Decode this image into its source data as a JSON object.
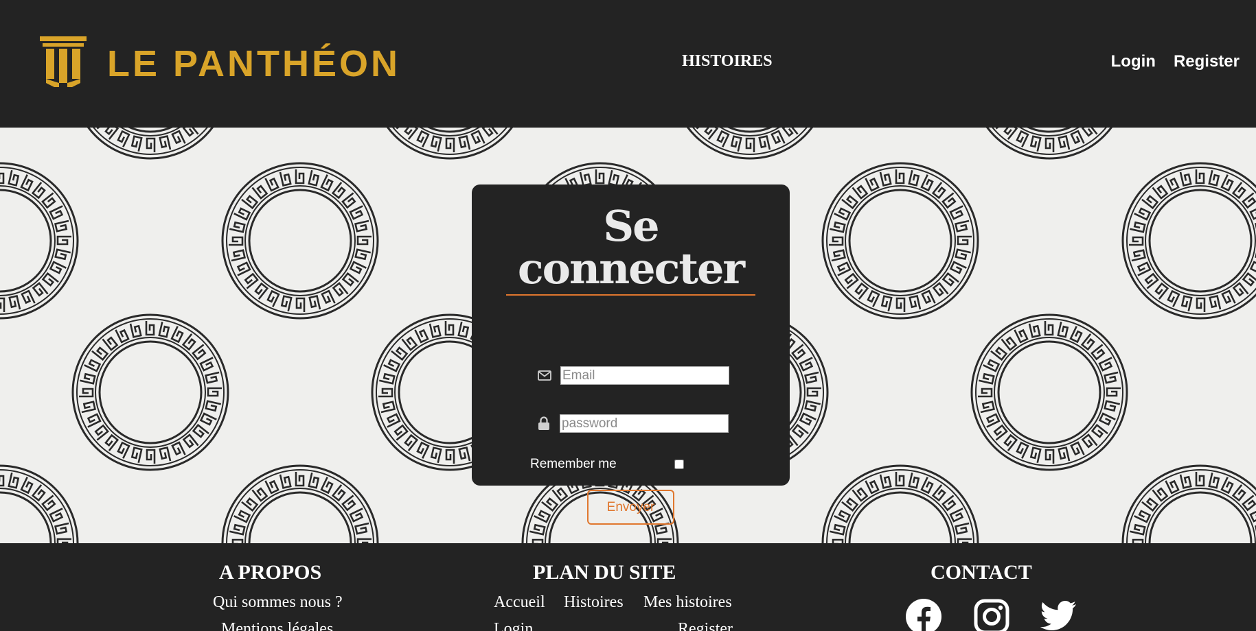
{
  "header": {
    "brand": "Le Panthéon",
    "nav_center": "HISTOIRES",
    "login": "Login",
    "register": "Register"
  },
  "login_card": {
    "title": "Se connecter",
    "email_placeholder": "Email",
    "password_placeholder": "password",
    "remember_label": "Remember me",
    "remember_checked": false,
    "submit_label": "Envoyer"
  },
  "footer": {
    "about": {
      "title": "A PROPOS",
      "links": [
        "Qui sommes nous ?",
        "Mentions légales"
      ]
    },
    "sitemap": {
      "title": "PLAN DU SITE",
      "links": [
        "Accueil",
        "Histoires",
        "Mes histoires",
        "Login",
        "Register"
      ]
    },
    "contact": {
      "title": "CONTACT",
      "socials": [
        "facebook-icon",
        "instagram-icon",
        "twitter-icon"
      ]
    }
  },
  "colors": {
    "dark": "#232323",
    "gold": "#d9a429",
    "accent_orange": "#e0772e",
    "background": "#efefed"
  }
}
